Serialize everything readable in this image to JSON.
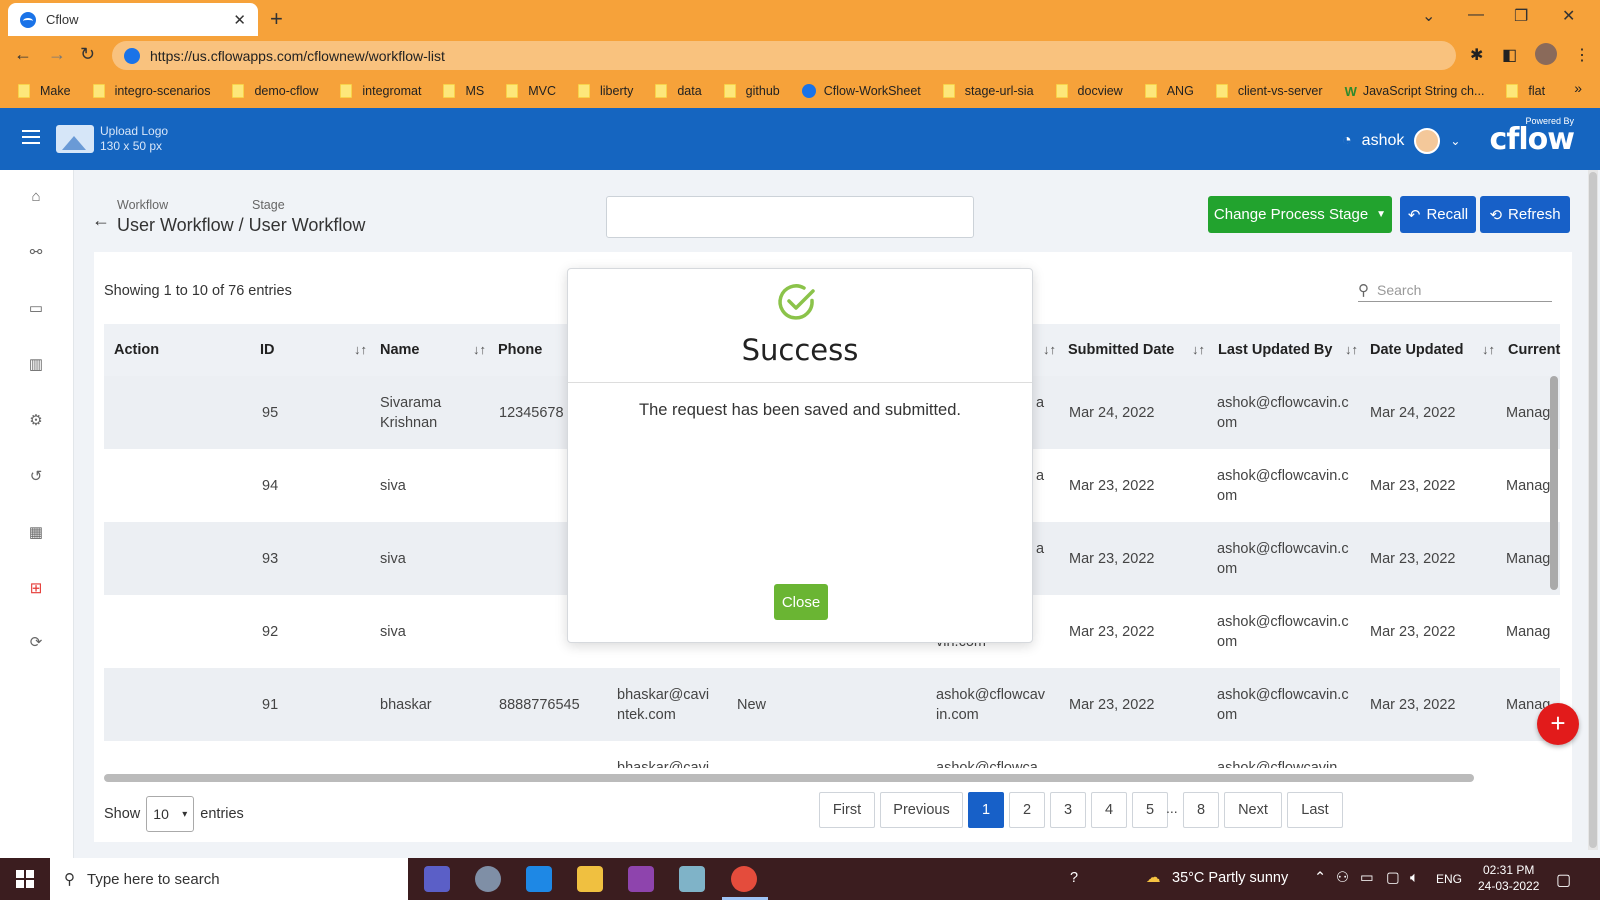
{
  "browser": {
    "tab_title": "Cflow",
    "tab_close": "✕",
    "new_tab": "+",
    "url": "https://us.cflowapps.com/cflownew/workflow-list",
    "bookmarks": [
      {
        "label": "Make",
        "icon": "folder-icon"
      },
      {
        "label": "integro-scenarios",
        "icon": "folder-icon"
      },
      {
        "label": "demo-cflow",
        "icon": "folder-icon"
      },
      {
        "label": "integromat",
        "icon": "folder-icon"
      },
      {
        "label": "MS",
        "icon": "folder-icon"
      },
      {
        "label": "MVC",
        "icon": "folder-icon"
      },
      {
        "label": "liberty",
        "icon": "folder-icon"
      },
      {
        "label": "data",
        "icon": "folder-icon"
      },
      {
        "label": "github",
        "icon": "folder-icon"
      },
      {
        "label": "Cflow-WorkSheet",
        "icon": "cflow-icon"
      },
      {
        "label": "stage-url-sia",
        "icon": "folder-icon"
      },
      {
        "label": "docview",
        "icon": "folder-icon"
      },
      {
        "label": "ANG",
        "icon": "folder-icon"
      },
      {
        "label": "client-vs-server",
        "icon": "folder-icon"
      },
      {
        "label": "JavaScript String ch...",
        "icon": "w3-icon"
      },
      {
        "label": "flat",
        "icon": "folder-icon"
      }
    ],
    "bookmarks_more": "»",
    "colors": {
      "chrome": "#f6a23a"
    }
  },
  "header": {
    "upload_logo_line1": "Upload Logo",
    "upload_logo_line2": "130 x 50 px",
    "username": "ashok",
    "powered_by": "Powered By",
    "brand": "cflow",
    "color": "#1565c0"
  },
  "breadcrumb": {
    "workflow_label": "Workflow",
    "stage_label": "Stage",
    "title": "User Workflow / User Workflow"
  },
  "actions": {
    "change_stage": "Change Process Stage",
    "recall": "Recall",
    "refresh": "Refresh"
  },
  "table": {
    "showing": "Showing 1 to 10 of 76 entries",
    "search_placeholder": "Search",
    "columns": [
      "Action",
      "ID",
      "Name",
      "Phone",
      "Submitted Date",
      "Last Updated By",
      "Date Updated",
      "Current"
    ],
    "rows": [
      {
        "id": "95",
        "name": "Sivarama Krishnan",
        "phone": "12345678",
        "email": "",
        "status": "",
        "created_by": "a",
        "submitted": "Mar 24, 2022",
        "updated_by": "ashok@cflowcavin.com",
        "date_updated": "Mar 24, 2022",
        "current": "Manag"
      },
      {
        "id": "94",
        "name": "siva",
        "phone": "",
        "email": "",
        "status": "",
        "created_by": "a",
        "submitted": "Mar 23, 2022",
        "updated_by": "ashok@cflowcavin.com",
        "date_updated": "Mar 23, 2022",
        "current": "Manag"
      },
      {
        "id": "93",
        "name": "siva",
        "phone": "",
        "email": "",
        "status": "",
        "created_by": "a",
        "submitted": "Mar 23, 2022",
        "updated_by": "ashok@cflowcavin.com",
        "date_updated": "Mar 23, 2022",
        "current": "Manag"
      },
      {
        "id": "92",
        "name": "siva",
        "phone": "",
        "email": "",
        "status": "",
        "created_by": "vin.com",
        "submitted": "Mar 23, 2022",
        "updated_by": "ashok@cflowcavin.com",
        "date_updated": "Mar 23, 2022",
        "current": "Manag"
      },
      {
        "id": "91",
        "name": "bhaskar",
        "phone": "8888776545",
        "email": "bhaskar@cavintek.com",
        "status": "New",
        "created_by": "ashok@cflowcavin.com",
        "submitted": "Mar 23, 2022",
        "updated_by": "ashok@cflowcavin.com",
        "date_updated": "Mar 23, 2022",
        "current": "Manag"
      }
    ],
    "partial_row": {
      "email": "bhaskar@cavi",
      "created_by": "ashok@cflowca",
      "updated_by": "ashok@cflowcavin"
    }
  },
  "footer": {
    "show": "Show",
    "entries_value": "10",
    "entries": "entries",
    "pager": [
      "First",
      "Previous",
      "1",
      "2",
      "3",
      "4",
      "5",
      "8",
      "Next",
      "Last"
    ],
    "ellipsis": "...",
    "active_page": "1"
  },
  "modal": {
    "title": "Success",
    "message": "The request has been saved and submitted.",
    "close_label": "Close",
    "check_color": "#8bc34a"
  },
  "taskbar": {
    "search_placeholder": "Type here to search",
    "weather": "35°C  Partly sunny",
    "lang": "ENG",
    "time": "02:31 PM",
    "date": "24-03-2022"
  }
}
